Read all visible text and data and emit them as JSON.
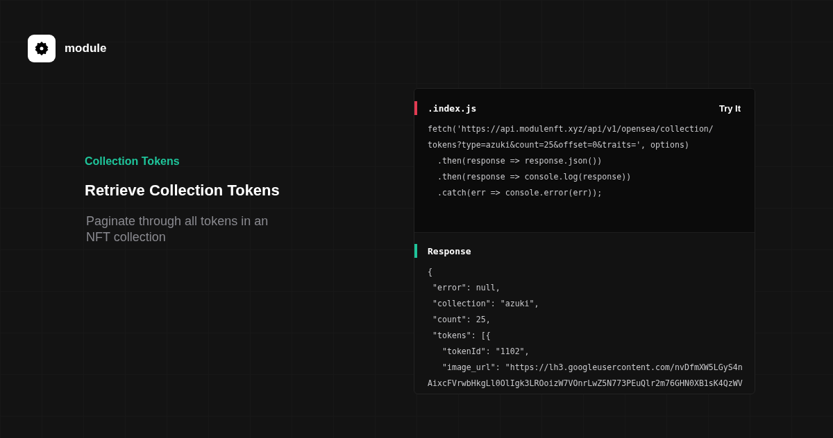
{
  "brand": {
    "name": "module"
  },
  "intro": {
    "eyebrow": "Collection Tokens",
    "title": "Retrieve Collection Tokens",
    "description": "Paginate through all tokens in an NFT collection"
  },
  "panels": [
    {
      "title": ".index.js",
      "color": "#e23b52",
      "action": "Try It",
      "lines": [
        "fetch('https://api.modulenft.xyz/api/v1/opensea/collection/",
        "tokens?type=azuki&count=25&offset=0&traits=', options)",
        "  .then(response => response.json())",
        "  .then(response => console.log(response))",
        "  .catch(err => console.error(err));"
      ]
    },
    {
      "title": "Response",
      "color": "#1fc49a",
      "lines": [
        "{",
        " \"error\": null,",
        " \"collection\": \"azuki\",",
        " \"count\": 25,",
        " \"tokens\": [{",
        "   \"tokenId\": \"1102\",",
        "   \"image_url\": \"https://lh3.googleusercontent.com/nvDfmXW5LGyS4n",
        "AixcFVrwbHkgLl0OlIgk3LROoizW7VOnrLwZ5N773PEuQlr2m76GHN0XB1sK4QzWV"
      ]
    }
  ]
}
